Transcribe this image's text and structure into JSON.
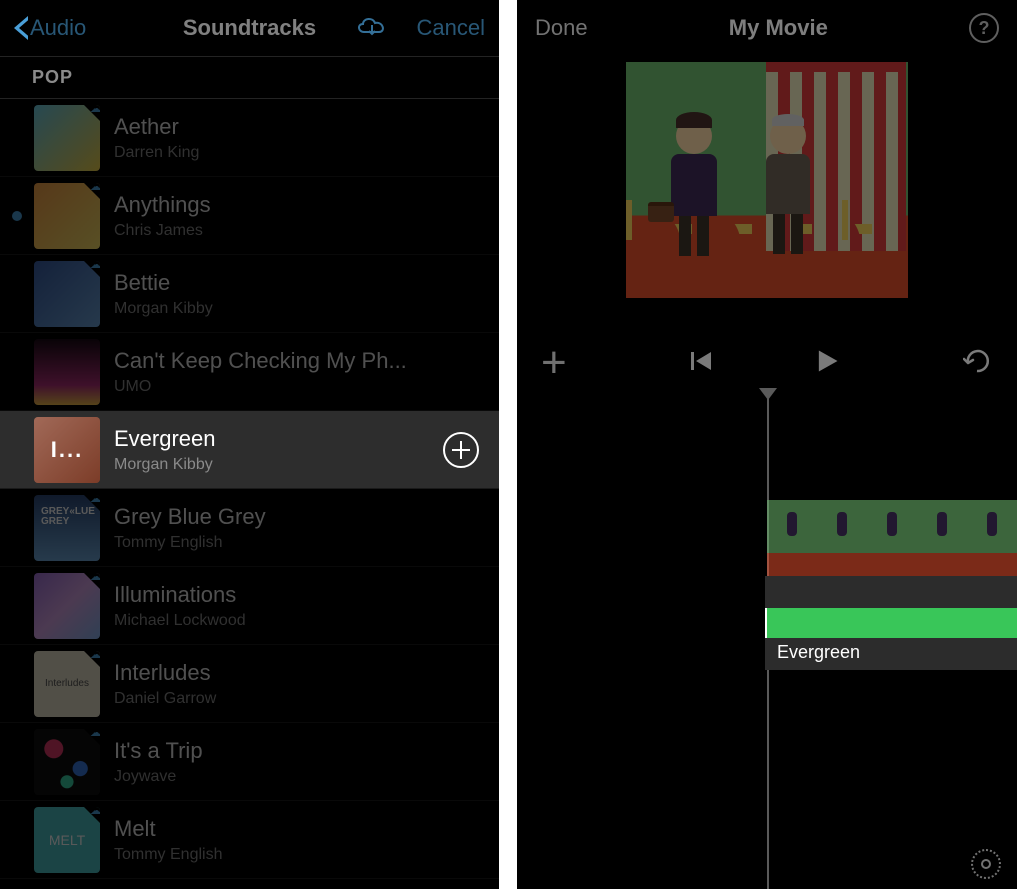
{
  "left": {
    "back_label": "Audio",
    "title": "Soundtracks",
    "cancel_label": "Cancel",
    "section_label": "POP",
    "tracks": [
      {
        "title": "Aether",
        "artist": "Darren King",
        "artClass": "art-0",
        "cloud": true
      },
      {
        "title": "Anythings",
        "artist": "Chris James",
        "artClass": "art-1",
        "cloud": true,
        "playing": true
      },
      {
        "title": "Bettie",
        "artist": "Morgan Kibby",
        "artClass": "art-2",
        "cloud": true
      },
      {
        "title": "Can't Keep Checking My Ph...",
        "artist": "UMO",
        "artClass": "art-3",
        "cloud": false
      },
      {
        "title": "Evergreen",
        "artist": "Morgan Kibby",
        "artClass": "art-4",
        "cloud": false,
        "selected": true,
        "pauseOverlay": "I..."
      },
      {
        "title": "Grey Blue Grey",
        "artist": "Tommy English",
        "artClass": "art-5",
        "cloud": true
      },
      {
        "title": "Illuminations",
        "artist": "Michael Lockwood",
        "artClass": "art-6",
        "cloud": true
      },
      {
        "title": "Interludes",
        "artist": "Daniel Garrow",
        "artClass": "art-7",
        "cloud": true,
        "artText": "Interludes"
      },
      {
        "title": "It's a Trip",
        "artist": "Joywave",
        "artClass": "art-8",
        "cloud": true
      },
      {
        "title": "Melt",
        "artist": "Tommy English",
        "artClass": "art-9",
        "cloud": true,
        "artText": "MELT"
      }
    ]
  },
  "right": {
    "done_label": "Done",
    "movie_title": "My Movie",
    "help_char": "?",
    "audio_clip_label": "Evergreen"
  }
}
